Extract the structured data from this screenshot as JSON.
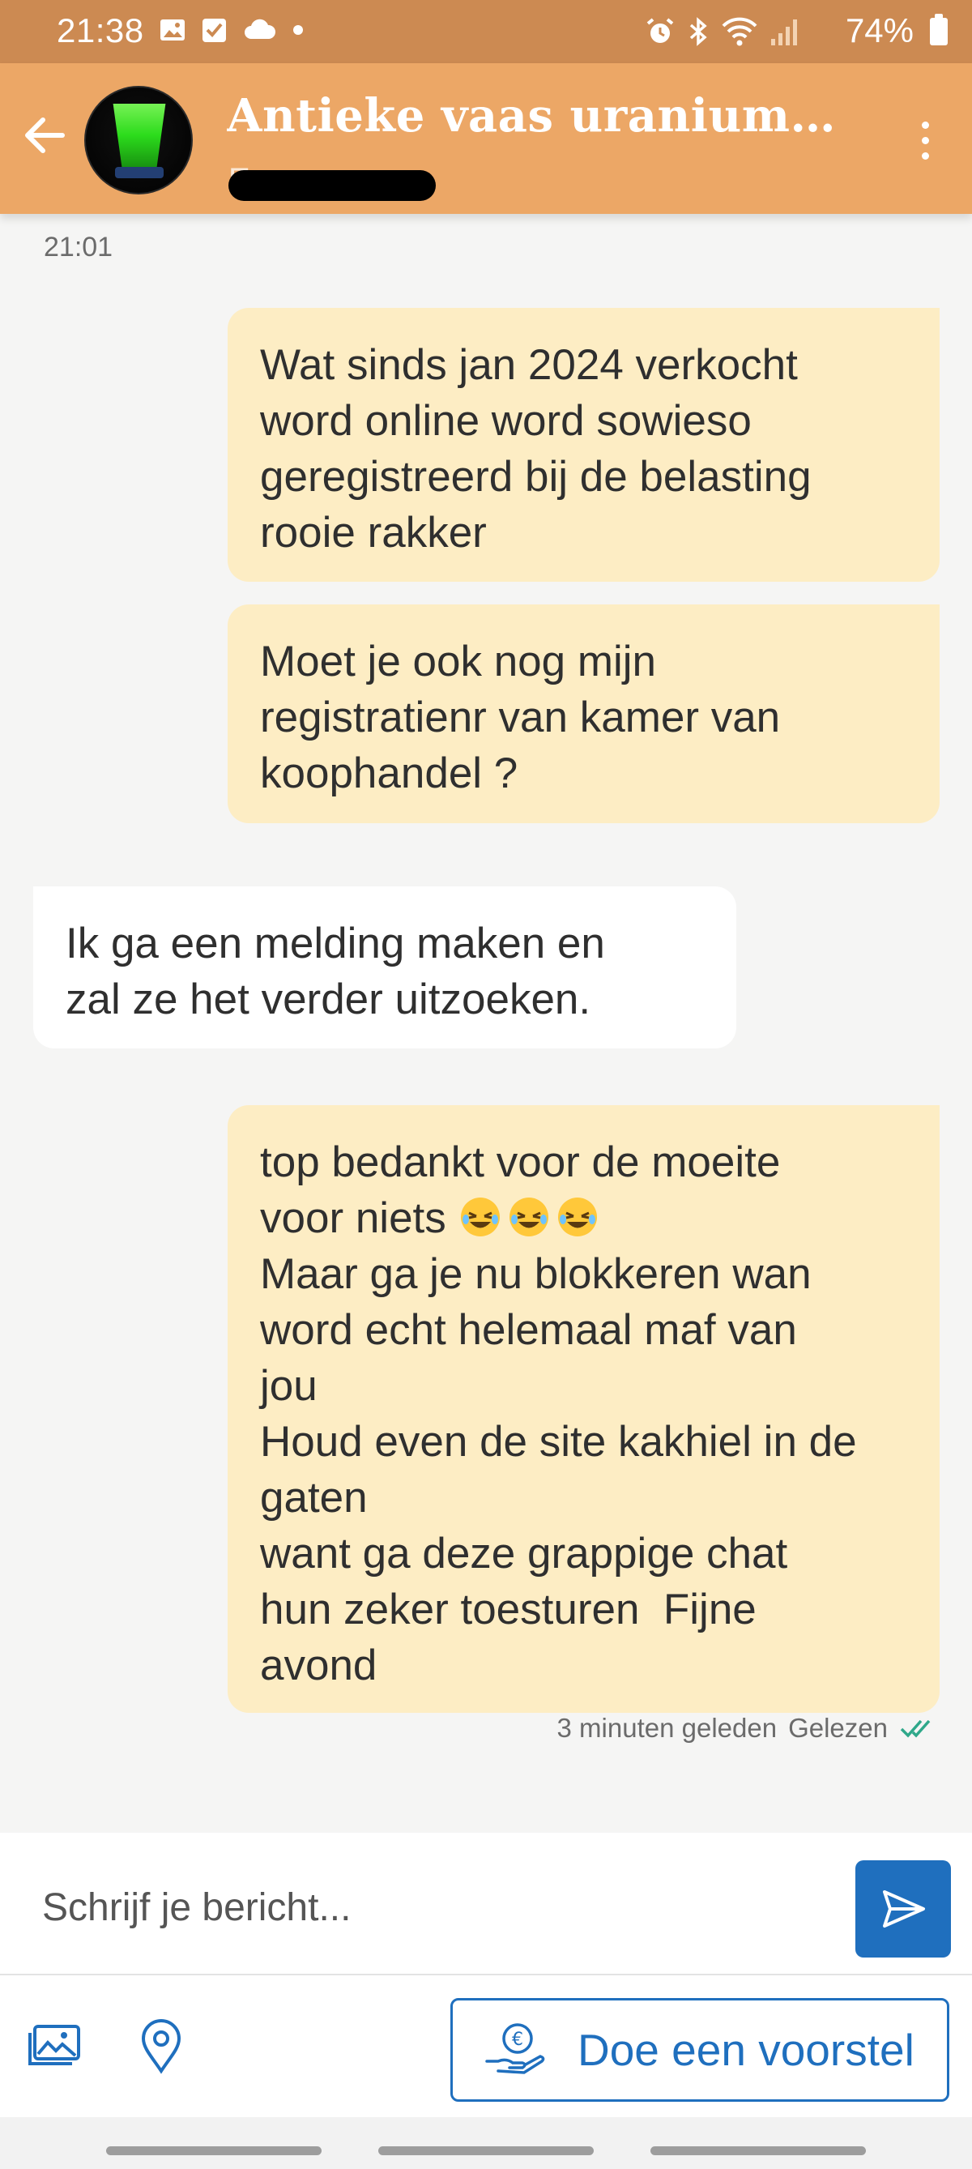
{
  "status_bar": {
    "time": "21:38",
    "battery": "74%",
    "left_icons": [
      "gallery-icon",
      "checkbox-icon",
      "cloud-icon",
      "dot-icon"
    ],
    "right_icons": [
      "alarm-icon",
      "bluetooth-icon",
      "wifi-icon",
      "signal-icon",
      "battery-icon"
    ]
  },
  "header": {
    "title": "Antieke vaas uraniumg...",
    "subtitle_partial": "E",
    "back_icon": "arrow-left-icon",
    "menu_icon": "more-vertical-icon",
    "accent_color": "#eca766"
  },
  "chat": {
    "date_label": "21:01",
    "messages": [
      {
        "direction": "outgoing",
        "text": "Wat sinds jan 2024 verkocht\nword online word sowieso\ngeregistreerd bij de belasting\nrooie rakker"
      },
      {
        "direction": "outgoing",
        "text": "Moet je ook nog mijn\nregistratienr van kamer van\nkoophandel ?"
      },
      {
        "direction": "incoming",
        "text": "Ik ga een melding maken en\nzal ze het verder uitzoeken."
      },
      {
        "direction": "outgoing",
        "text_before_emoji": "top bedankt voor de moeite\nvoor niets ",
        "emoji": [
          "rolling-on-floor-laughing",
          "rolling-on-floor-laughing",
          "rolling-on-floor-laughing"
        ],
        "text_after_emoji": "\nMaar ga je nu blokkeren wan\nword echt helemaal maf van\njou\nHoud even de site kakhiel in de\ngaten\nwant ga deze grappige chat\nhun zeker toesturen  Fijne\navond"
      }
    ],
    "meta": {
      "time_ago": "3 minuten geleden",
      "read_status": "Gelezen",
      "read_icon": "double-check-icon"
    },
    "outgoing_color": "#fdedc4",
    "incoming_color": "#ffffff"
  },
  "composer": {
    "placeholder": "Schrijf je bericht...",
    "send_icon": "send-icon"
  },
  "toolbar": {
    "photo_icon": "photo-icon",
    "location_icon": "location-pin-icon",
    "offer_label": "Doe een voorstel",
    "offer_icon": "euro-hand-icon",
    "brand_color": "#1f6fbe"
  }
}
